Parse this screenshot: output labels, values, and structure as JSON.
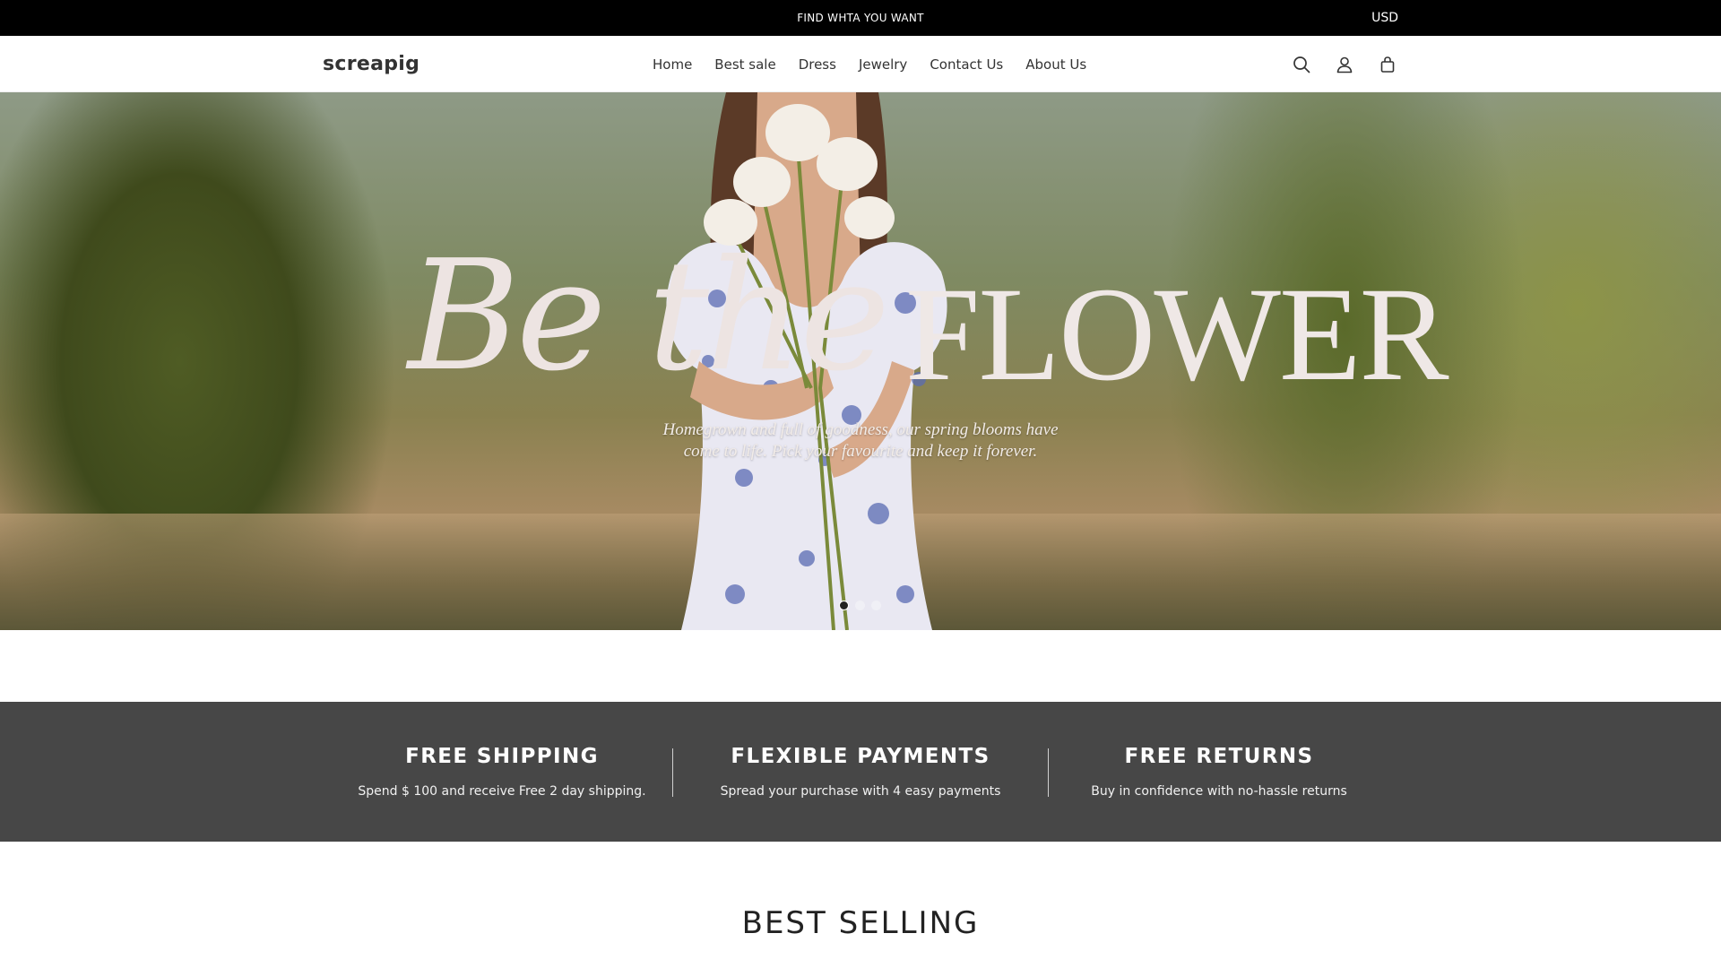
{
  "announcement": {
    "text": "FIND WHTA YOU WANT",
    "currency": "USD"
  },
  "header": {
    "logo": "screapig",
    "nav": [
      "Home",
      "Best sale",
      "Dress",
      "Jewelry",
      "Contact Us",
      "About Us"
    ],
    "icons": [
      "search-icon",
      "account-icon",
      "cart-icon"
    ]
  },
  "hero": {
    "title_script": "Be the",
    "title_caps": "FLOWER",
    "subtitle_line1": "Homegrown and full of goodness, our spring blooms have",
    "subtitle_line2": "come to life. Pick your favourite and keep it forever.",
    "slides_total": 3,
    "active_slide": 1
  },
  "features": [
    {
      "title": "FREE SHIPPING",
      "text": "Spend $ 100 and receive Free 2 day shipping."
    },
    {
      "title": "FLEXIBLE PAYMENTS",
      "text": "Spread your purchase with 4 easy payments"
    },
    {
      "title": "FREE RETURNS",
      "text": "Buy in confidence with no-hassle returns"
    }
  ],
  "sections": {
    "best_selling": "BEST SELLING"
  },
  "colors": {
    "announcement_bg": "#000000",
    "features_bg": "#474747",
    "hero_text": "#EDE4E2"
  }
}
